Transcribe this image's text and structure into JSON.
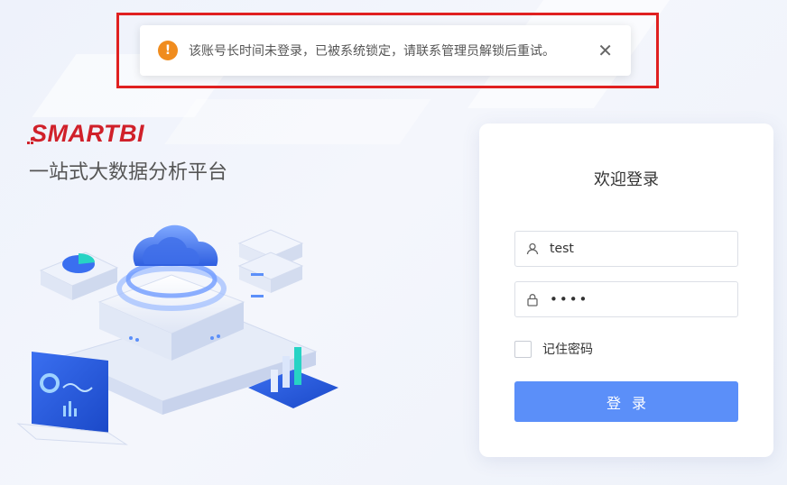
{
  "alert": {
    "icon": "warning-icon",
    "message": "该账号长时间未登录，已被系统锁定，请联系管理员解锁后重试。",
    "close_icon": "close-icon"
  },
  "brand": {
    "logo_text": "SMARTBI",
    "tagline": "一站式大数据分析平台"
  },
  "login": {
    "title": "欢迎登录",
    "username_value": "test",
    "password_value": "••••",
    "remember_label": "记住密码",
    "submit_label": "登录"
  },
  "colors": {
    "accent": "#5b8ff9",
    "brand_red": "#d0202a",
    "warning": "#f08c1e",
    "highlight_border": "#e02020"
  }
}
